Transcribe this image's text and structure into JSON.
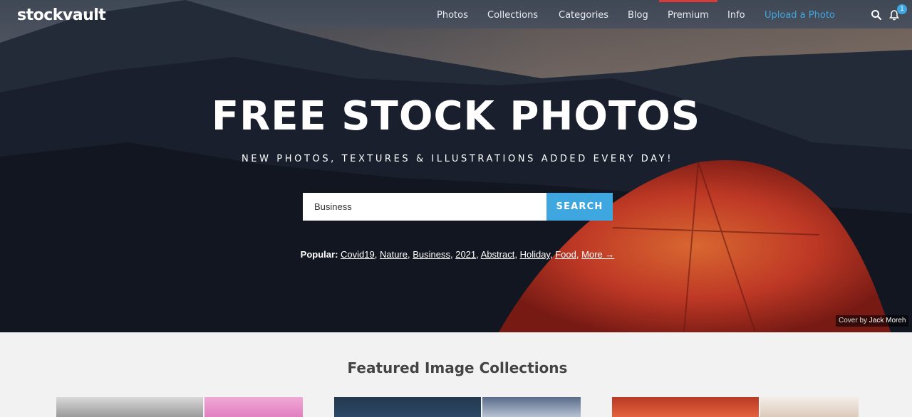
{
  "brand": {
    "logo_text": "stockvault"
  },
  "nav": {
    "items": [
      {
        "label": "Photos"
      },
      {
        "label": "Collections"
      },
      {
        "label": "Categories"
      },
      {
        "label": "Blog"
      },
      {
        "label": "Premium"
      },
      {
        "label": "Info"
      },
      {
        "label": "Upload a Photo"
      }
    ],
    "search_icon": "search-icon",
    "bell_icon": "bell-icon",
    "notification_count": "1"
  },
  "hero": {
    "title": "FREE STOCK PHOTOS",
    "subtitle": "NEW PHOTOS, TEXTURES & ILLUSTRATIONS ADDED EVERY DAY!",
    "search": {
      "value": "Business",
      "button_label": "SEARCH"
    },
    "popular": {
      "label": "Popular:",
      "tags": [
        "Covid19",
        "Nature",
        "Business",
        "2021",
        "Abstract",
        "Holiday",
        "Food"
      ],
      "more_label": "More →"
    },
    "cover_credit": {
      "prefix": "Cover by",
      "author": "Jack Moreh"
    }
  },
  "featured": {
    "title": "Featured Image Collections"
  },
  "colors": {
    "accent": "#3ea7e0",
    "premium_bar": "#d93b3b",
    "tent": "#e0432c"
  }
}
